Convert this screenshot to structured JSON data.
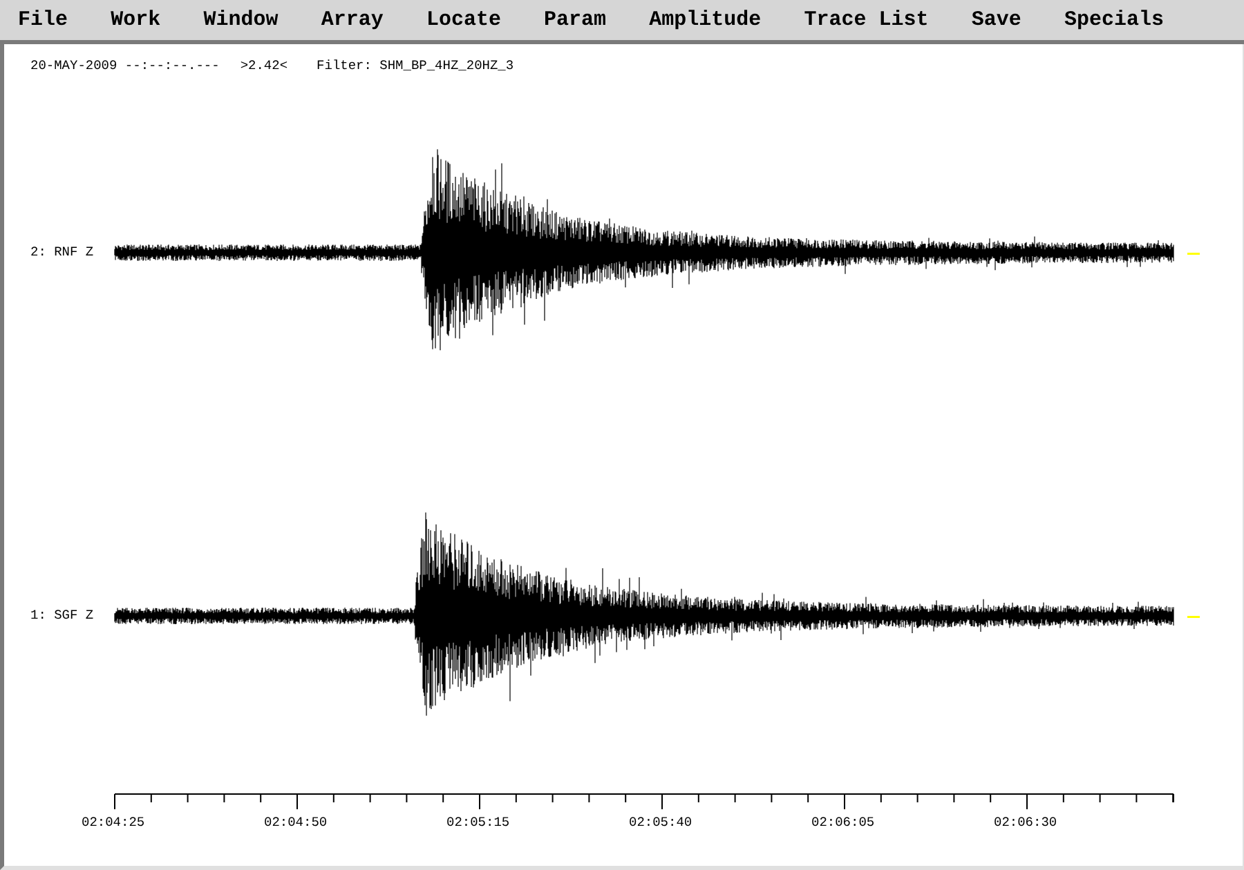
{
  "menu_bar": {
    "items": [
      "File",
      "Work",
      "Window",
      "Array",
      "Locate",
      "Param",
      "Amplitude",
      "Trace List",
      "Save",
      "Specials"
    ]
  },
  "info_line": {
    "datetime": "20-MAY-2009 --:--:--.---",
    "reading": ">2.42<",
    "filter": "Filter: SHM_BP_4HZ_20HZ_3"
  },
  "traces": [
    {
      "label": "2: RNF Z"
    },
    {
      "label": "1: SGF Z"
    }
  ],
  "time_axis": {
    "labels": [
      "02:04:25",
      "02:04:50",
      "02:05:15",
      "02:05:40",
      "02:06:05",
      "02:06:30"
    ]
  }
}
